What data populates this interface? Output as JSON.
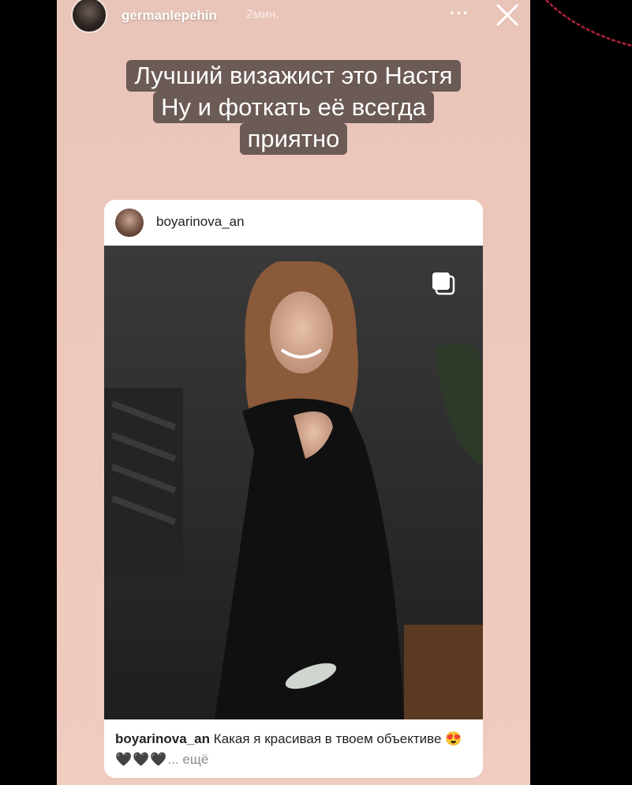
{
  "story": {
    "username": "germanlepehin",
    "time": "2мин.",
    "more_icon": "more-icon",
    "close_icon": "close-icon",
    "caption_lines": [
      "Лучший визажист это Настя",
      "Ну и фоткать её всегда",
      "приятно"
    ]
  },
  "post": {
    "username": "boyarinova_an",
    "multi_icon": "multiple-photos-icon",
    "caption_user": "boyarinova_an",
    "caption_text": "Какая я красивая в твоем объективе",
    "emoji": "😍",
    "hearts": "🖤🖤🖤",
    "more": "... ещё"
  },
  "colors": {
    "story_bg": "#e9c4b8",
    "caption_bg": "#6b5a55"
  }
}
